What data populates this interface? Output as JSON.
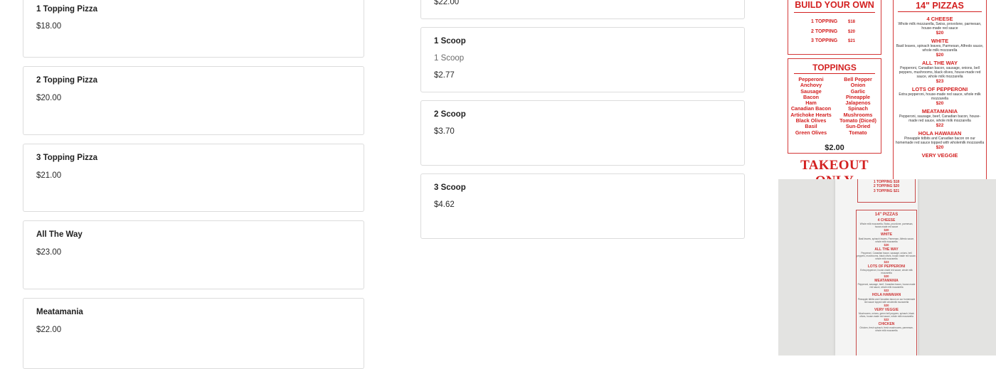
{
  "left_items": [
    {
      "title": "1 Topping Pizza",
      "price": "$18.00"
    },
    {
      "title": "2 Topping Pizza",
      "price": "$20.00"
    },
    {
      "title": "3 Topping Pizza",
      "price": "$21.00"
    },
    {
      "title": "All The Way",
      "price": "$23.00"
    },
    {
      "title": "Meatamania",
      "price": "$22.00"
    }
  ],
  "mid_items": [
    {
      "title": "",
      "sub": "",
      "price": "$22.00"
    },
    {
      "title": "1 Scoop",
      "sub": "1 Scoop",
      "price": "$2.77"
    },
    {
      "title": "2 Scoop",
      "sub": "",
      "price": "$3.70"
    },
    {
      "title": "3 Scoop",
      "sub": "",
      "price": "$4.62"
    }
  ],
  "menu_image": {
    "build_your_own": {
      "title": "BUILD YOUR OWN",
      "rows": [
        {
          "label": "1 TOPPING",
          "price": "$18"
        },
        {
          "label": "2 TOPPING",
          "price": "$20"
        },
        {
          "label": "3 TOPPING",
          "price": "$21"
        }
      ]
    },
    "toppings": {
      "title": "TOPPINGS",
      "left": [
        "Pepperoni",
        "Anchovy",
        "Sausage",
        "Bacon",
        "Ham",
        "Canadian Bacon",
        "Artichoke Hearts",
        "Black Olives",
        "Basil",
        "Green Olives"
      ],
      "right": [
        "Bell Pepper",
        "Onion",
        "Garlic",
        "Pineapple",
        "Jalapenos",
        "Spinach",
        "Mushrooms",
        "Tomato (Diced)",
        "Sun-Dried",
        "Tomato"
      ],
      "price": "$2.00"
    },
    "takeout": "TAKEOUT ONLY",
    "pizzas": {
      "title": "14\" PIZZAS",
      "items": [
        {
          "name": "4 CHEESE",
          "desc": "Whole milk mozzarella, Swiss, provolone, parmesan, house-made red sauce",
          "price": "$20"
        },
        {
          "name": "WHITE",
          "desc": "Basil leaves, spinach leaves, Parmesan, Alfredo sauce, whole milk mozzarella",
          "price": "$20"
        },
        {
          "name": "ALL THE WAY",
          "desc": "Pepperoni, Canadian bacon, sausage, onions, bell peppers, mushrooms, black olives, house-made red sauce, whole milk mozzarella",
          "price": "$23"
        },
        {
          "name": "LOTS OF PEPPERONI",
          "desc": "Extra pepperoni, house-made red sauce, whole milk mozzarella",
          "price": "$20"
        },
        {
          "name": "MEATAMANIA",
          "desc": "Pepperoni, sausage, beef, Canadian bacon, house-made red sauce, whole milk mozzarella",
          "price": "$22"
        },
        {
          "name": "HOLA HAWAIIAN",
          "desc": "Pineapple tidbits and Canadian bacon on our homemade red sauce topped with wholemilk mozzarella",
          "price": "$20"
        },
        {
          "name": "VERY VEGGIE",
          "desc": "",
          "price": ""
        }
      ]
    },
    "photo": {
      "rows": [
        {
          "label": "1 TOPPING",
          "price": "$18"
        },
        {
          "label": "2 TOPPING",
          "price": "$20"
        },
        {
          "label": "3 TOPPING",
          "price": "$21"
        }
      ],
      "pizzas_title": "14\" PIZZAS",
      "items": [
        {
          "name": "4 CHEESE",
          "desc": "Whole milk mozzarella, Swiss, provolone, parmesan, house-made red sauce",
          "price": "$20"
        },
        {
          "name": "WHITE",
          "desc": "Basil leaves, spinach leaves, Parmesan, Alfredo sauce, whole milk mozzarella",
          "price": "$20"
        },
        {
          "name": "ALL THE WAY",
          "desc": "Pepperoni, Canadian bacon, sausage, onions, bell peppers, mushrooms, black olives, house-made red sauce, whole milk mozzarella",
          "price": "$23"
        },
        {
          "name": "LOTS OF PEPPERONI",
          "desc": "Extra pepperoni, house-made red sauce, whole milk mozzarella",
          "price": "$20"
        },
        {
          "name": "MEATAMANIA",
          "desc": "Pepperoni, sausage, beef, Canadian bacon, house-made red sauce, whole milk mozzarella",
          "price": "$22"
        },
        {
          "name": "HOLA HAWAIIAN",
          "desc": "Pineapple tidbits and Canadian bacon on our homemade red sauce topped with wholemilk mozzarella",
          "price": "$20"
        },
        {
          "name": "VERY VEGGIE",
          "desc": "Mushrooms, onions, green bell peppers, spinach, black olives, house-made red sauce, whole milk mozzarella",
          "price": "$22"
        },
        {
          "name": "CHICKEN",
          "desc": "Chicken, fresh spinach, fresh mushrooms, parmesan, whole milk mozzarella",
          "price": ""
        }
      ]
    }
  },
  "colors": {
    "accent_red": "#d32020",
    "card_border": "#dcdcdc"
  }
}
